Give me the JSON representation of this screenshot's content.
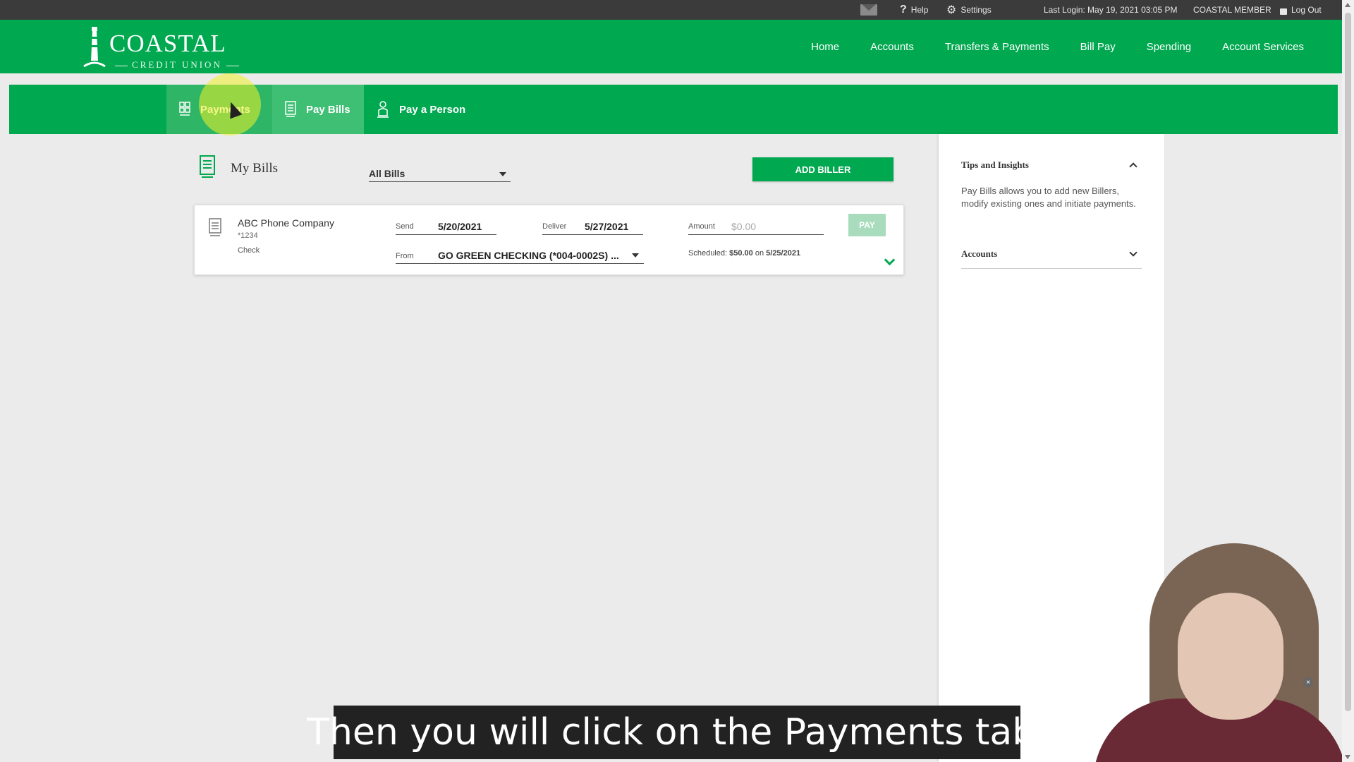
{
  "topbar": {
    "help": "Help",
    "settings": "Settings",
    "last_login": "Last Login: May 19, 2021 03:05 PM",
    "member": "COASTAL MEMBER",
    "logout": "Log Out"
  },
  "logo": {
    "word": "COASTAL",
    "sub": "CREDIT UNION"
  },
  "main_nav": {
    "home": "Home",
    "accounts": "Accounts",
    "transfers": "Transfers & Payments",
    "bill_pay": "Bill Pay",
    "spending": "Spending",
    "account_services": "Account Services"
  },
  "sub_nav": {
    "payments": "Payments",
    "pay_bills": "Pay Bills",
    "pay_person": "Pay a Person"
  },
  "my_bills": {
    "title": "My Bills",
    "filter": "All Bills",
    "add_biller": "ADD BILLER"
  },
  "bill": {
    "payee": "ABC Phone Company",
    "account": "*1234",
    "method": "Check",
    "send_label": "Send",
    "send_date": "5/20/2021",
    "deliver_label": "Deliver",
    "deliver_date": "5/27/2021",
    "amount_label": "Amount",
    "amount_placeholder": "$0.00",
    "from_label": "From",
    "from_account": "GO GREEN CHECKING (*004-0002S) ...",
    "scheduled_label": "Scheduled:",
    "scheduled_amount": "$50.00",
    "scheduled_on": "on",
    "scheduled_date": "5/25/2021",
    "pay_button": "PAY"
  },
  "side_panel": {
    "tips_title": "Tips and Insights",
    "tips_text": "Pay Bills allows you to add new Billers, modify existing ones and initiate payments.",
    "accounts_title": "Accounts"
  },
  "caption": "Then you will click on the Payments tab.",
  "colors": {
    "brand_green": "#00a84f",
    "pay_disabled": "#a8dcbd",
    "topbar": "#3b3b3b"
  }
}
